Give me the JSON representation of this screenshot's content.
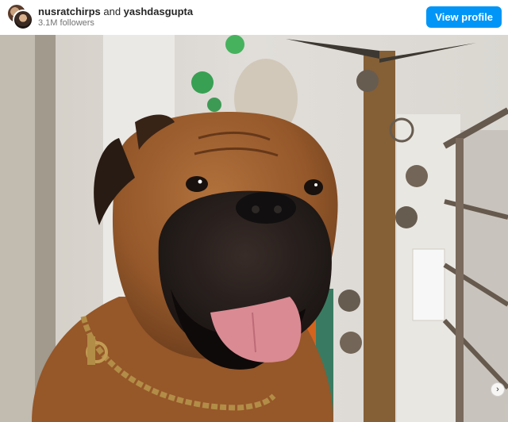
{
  "header": {
    "user1": "nusratchirps",
    "connector": " and ",
    "user2": "yashdasgupta",
    "followers": "3.1M followers",
    "view_profile": "View profile"
  },
  "photo": {
    "subject": "dog-portrait"
  },
  "icons": {
    "next": "chevron-right-icon"
  }
}
